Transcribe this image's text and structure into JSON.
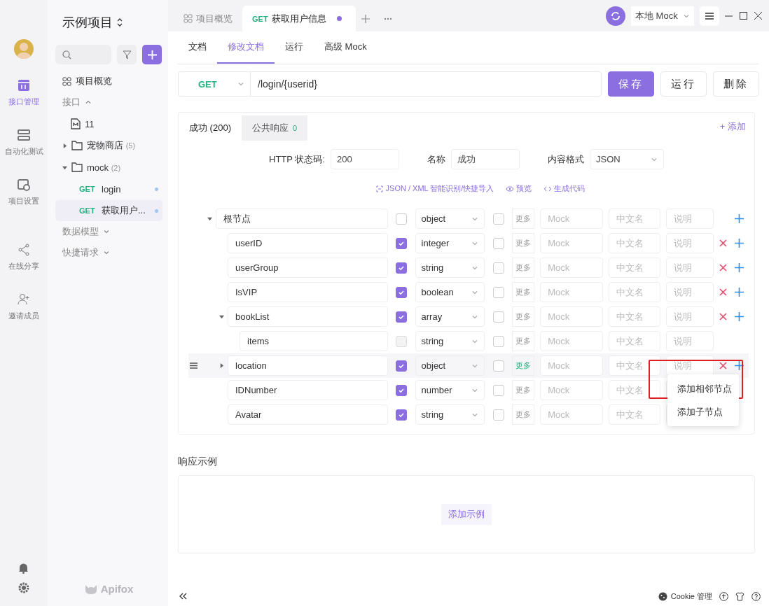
{
  "rail": {
    "items": [
      {
        "label": "接口管理",
        "selected": true
      },
      {
        "label": "自动化测试",
        "selected": false
      },
      {
        "label": "项目设置",
        "selected": false
      },
      {
        "label": "在线分享",
        "selected": false
      },
      {
        "label": "邀请成员",
        "selected": false
      }
    ]
  },
  "sidebar": {
    "project": "示例项目",
    "overview": "项目概览",
    "section": "接口",
    "logo": "Apifox",
    "tree": [
      {
        "kind": "doc",
        "label": "11"
      },
      {
        "kind": "folder",
        "label": "宠物商店",
        "count": "(5)",
        "expanded": false
      },
      {
        "kind": "folder",
        "label": "mock",
        "count": "(2)",
        "expanded": true,
        "children": [
          {
            "kind": "api",
            "method": "GET",
            "label": "login",
            "selected": false
          },
          {
            "kind": "api",
            "method": "GET",
            "label": "获取用户...",
            "selected": true
          }
        ]
      }
    ],
    "sections": [
      "数据模型",
      "快捷请求"
    ]
  },
  "tabs": [
    {
      "kind": "overview",
      "label": "项目概览",
      "selected": false
    },
    {
      "kind": "api",
      "method": "GET",
      "label": "获取用户信息",
      "selected": true,
      "unsaved": true
    }
  ],
  "env": {
    "value": "本地 Mock"
  },
  "subtabs": [
    {
      "label": "文档",
      "selected": false
    },
    {
      "label": "修改文档",
      "selected": true
    },
    {
      "label": "运行",
      "selected": false
    },
    {
      "label": "高级 Mock",
      "selected": false
    }
  ],
  "request": {
    "method": "GET",
    "url": "/login/{userid}",
    "buttons": [
      {
        "label": "保存",
        "kind": "primary"
      },
      {
        "label": "运行",
        "kind": "default"
      },
      {
        "label": "删除",
        "kind": "default"
      }
    ]
  },
  "response": {
    "tabs": [
      {
        "label": "成功 (200)",
        "selected": true
      },
      {
        "label": "公共响应",
        "count": "0",
        "selected": false
      }
    ],
    "add": "+ 添加",
    "fields": [
      {
        "label": "HTTP 状态码:",
        "value": "200",
        "kind": "input"
      },
      {
        "label": "名称",
        "value": "成功",
        "kind": "input"
      },
      {
        "label": "内容格式",
        "value": "JSON",
        "kind": "select"
      }
    ],
    "tools": [
      "JSON / XML 智能识别/快捷导入",
      "预览",
      "生成代码"
    ],
    "schema": [
      {
        "name": "根节点",
        "required": false,
        "disabled": false,
        "type": "object",
        "nullable": false,
        "more": "更多",
        "mock": "Mock",
        "cn": "中文名",
        "desc": "说明",
        "deletable": false,
        "addable": true,
        "hovered": false,
        "expanded": true,
        "children": [
          {
            "name": "userID",
            "required": true,
            "disabled": false,
            "type": "integer",
            "nullable": false,
            "more": "更多",
            "mock": "Mock",
            "cn": "中文名",
            "desc": "说明",
            "deletable": true,
            "addable": true,
            "hovered": false
          },
          {
            "name": "userGroup",
            "required": true,
            "disabled": false,
            "type": "string",
            "nullable": false,
            "more": "更多",
            "mock": "Mock",
            "cn": "中文名",
            "desc": "说明",
            "deletable": true,
            "addable": true,
            "hovered": false
          },
          {
            "name": "IsVIP",
            "required": true,
            "disabled": false,
            "type": "boolean",
            "nullable": false,
            "more": "更多",
            "mock": "Mock",
            "cn": "中文名",
            "desc": "说明",
            "deletable": true,
            "addable": true,
            "hovered": false
          },
          {
            "name": "bookList",
            "required": true,
            "disabled": false,
            "type": "array",
            "nullable": false,
            "more": "更多",
            "mock": "Mock",
            "cn": "中文名",
            "desc": "说明",
            "deletable": true,
            "addable": true,
            "hovered": false,
            "expanded": true,
            "children": [
              {
                "name": "items",
                "required": false,
                "disabled": true,
                "type": "string",
                "nullable": false,
                "more": "更多",
                "mock": "Mock",
                "cn": "中文名",
                "desc": "说明",
                "deletable": false,
                "addable": false,
                "hovered": false
              }
            ]
          },
          {
            "name": "location",
            "required": true,
            "disabled": false,
            "type": "object",
            "nullable": false,
            "more": "更多",
            "mock": "Mock",
            "cn": "中文名",
            "desc": "说明",
            "deletable": true,
            "addable": true,
            "hovered": true,
            "expanded": false
          },
          {
            "name": "IDNumber",
            "required": true,
            "disabled": false,
            "type": "number",
            "nullable": false,
            "more": "更多",
            "mock": "Mock",
            "cn": "中文名",
            "deletable": false,
            "addable": false,
            "hovered": false
          },
          {
            "name": "Avatar",
            "required": true,
            "disabled": false,
            "type": "string",
            "nullable": false,
            "more": "更多",
            "mock": "Mock",
            "cn": "中文名",
            "deletable": false,
            "addable": false,
            "hovered": false
          }
        ]
      }
    ],
    "menu": [
      {
        "label": "添加相邻节点",
        "highlighted": true
      },
      {
        "label": "添加子节点",
        "highlighted": false
      }
    ]
  },
  "examples": {
    "title": "响应示例",
    "button": "添加示例"
  },
  "footer": {
    "cookie": "Cookie 管理"
  }
}
